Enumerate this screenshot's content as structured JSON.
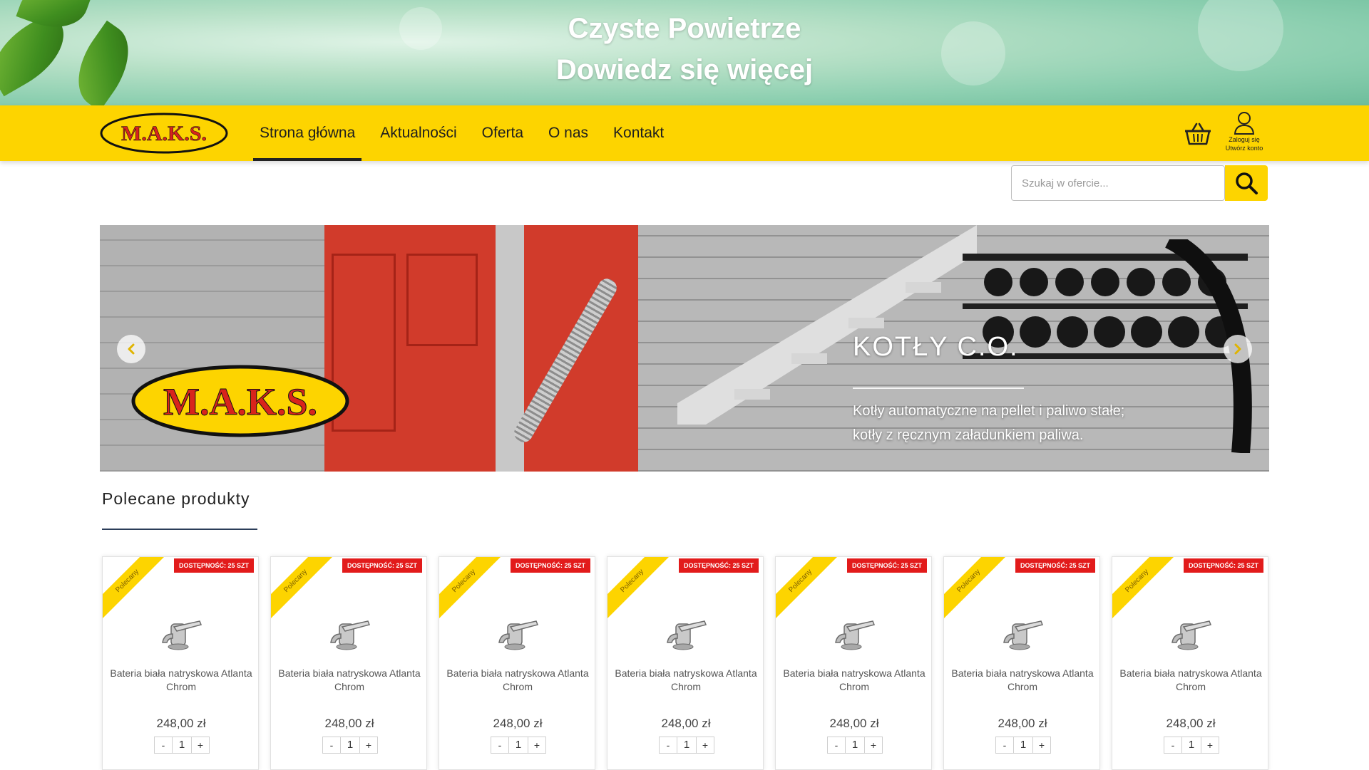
{
  "promo": {
    "line1": "Czyste Powietrze",
    "line2": "Dowiedz się więcej"
  },
  "brand": {
    "logo_text": "M.A.K.S.",
    "accent": "#fdd400",
    "logo_red": "#d8241c"
  },
  "nav": {
    "items": [
      {
        "label": "Strona główna",
        "active": true
      },
      {
        "label": "Aktualności"
      },
      {
        "label": "Oferta"
      },
      {
        "label": "O nas"
      },
      {
        "label": "Kontakt"
      }
    ]
  },
  "account": {
    "login": "Zaloguj się",
    "register": "Utwórz konto"
  },
  "search": {
    "placeholder": "Szukaj w ofercie..."
  },
  "hero": {
    "title": "KOTŁY C.O.",
    "line1": "Kotły automatyczne na pellet i paliwo stałe;",
    "line2": "kotły z ręcznym załadunkiem paliwa."
  },
  "recommended": {
    "title": "Polecane produkty",
    "products": [
      {
        "badge": "Polecany",
        "stock": "DOSTĘPNOŚĆ: 25 SZT",
        "name": "Bateria biała natryskowa Atlanta Chrom",
        "price": "248,00 zł",
        "qty": "1"
      },
      {
        "badge": "Polecany",
        "stock": "DOSTĘPNOŚĆ: 25 SZT",
        "name": "Bateria biała natryskowa Atlanta Chrom",
        "price": "248,00 zł",
        "qty": "1"
      },
      {
        "badge": "Polecany",
        "stock": "DOSTĘPNOŚĆ: 25 SZT",
        "name": "Bateria biała natryskowa Atlanta Chrom",
        "price": "248,00 zł",
        "qty": "1"
      },
      {
        "badge": "Polecany",
        "stock": "DOSTĘPNOŚĆ: 25 SZT",
        "name": "Bateria biała natryskowa Atlanta Chrom",
        "price": "248,00 zł",
        "qty": "1"
      },
      {
        "badge": "Polecany",
        "stock": "DOSTĘPNOŚĆ: 25 SZT",
        "name": "Bateria biała natryskowa Atlanta Chrom",
        "price": "248,00 zł",
        "qty": "1"
      },
      {
        "badge": "Polecany",
        "stock": "DOSTĘPNOŚĆ: 25 SZT",
        "name": "Bateria biała natryskowa Atlanta Chrom",
        "price": "248,00 zł",
        "qty": "1"
      },
      {
        "badge": "Polecany",
        "stock": "DOSTĘPNOŚĆ: 25 SZT",
        "name": "Bateria biała natryskowa Atlanta Chrom",
        "price": "248,00 zł",
        "qty": "1"
      }
    ],
    "qty_minus": "-",
    "qty_plus": "+"
  },
  "icons": {
    "cart": "shopping-basket-icon",
    "account": "user-icon",
    "search": "magnifier-icon",
    "prev": "chevron-left-icon",
    "next": "chevron-right-icon"
  }
}
